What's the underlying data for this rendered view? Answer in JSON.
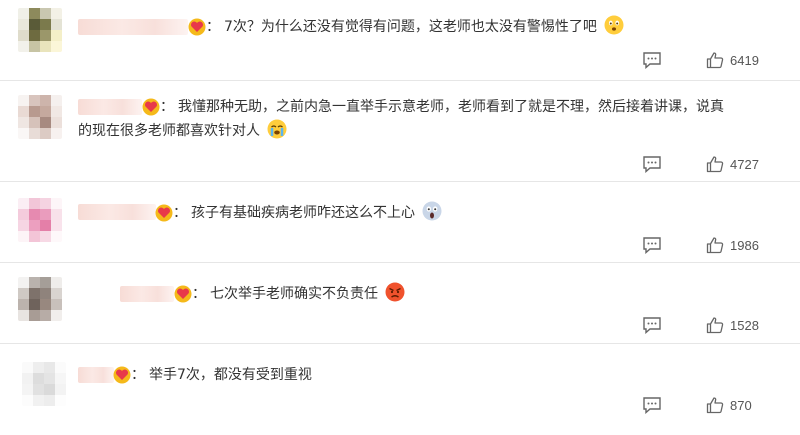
{
  "comments": [
    {
      "colon": "：",
      "text": "7次？为什么还没有觉得有问题，这老师也太没有警惕性了吧",
      "emoji_icon": "worried-face-emoji",
      "likes": "6419"
    },
    {
      "colon": "：",
      "text_line1": "我懂那种无助，之前内急一直举手示意老师，老师看到了就是不理，然后接着讲课，说真",
      "text_line2": "的现在很多老师都喜欢针对人",
      "emoji_icon": "crying-face-emoji",
      "likes": "4727"
    },
    {
      "colon": "：",
      "text": "孩子有基础疾病老师咋还这么不上心",
      "emoji_icon": "screaming-face-emoji",
      "likes": "1986"
    },
    {
      "colon": "：",
      "text": "七次举手老师确实不负责任",
      "emoji_icon": "angry-face-emoji",
      "likes": "1528"
    },
    {
      "colon": "：",
      "text": "举手7次，都没有受到重视",
      "emoji_icon": "",
      "likes": "870"
    }
  ],
  "colors": {
    "text": "#333333",
    "icon": "#666666",
    "divider": "#e6e6e6",
    "badge": "#e8394a",
    "badge_ring": "#f5b91a"
  }
}
